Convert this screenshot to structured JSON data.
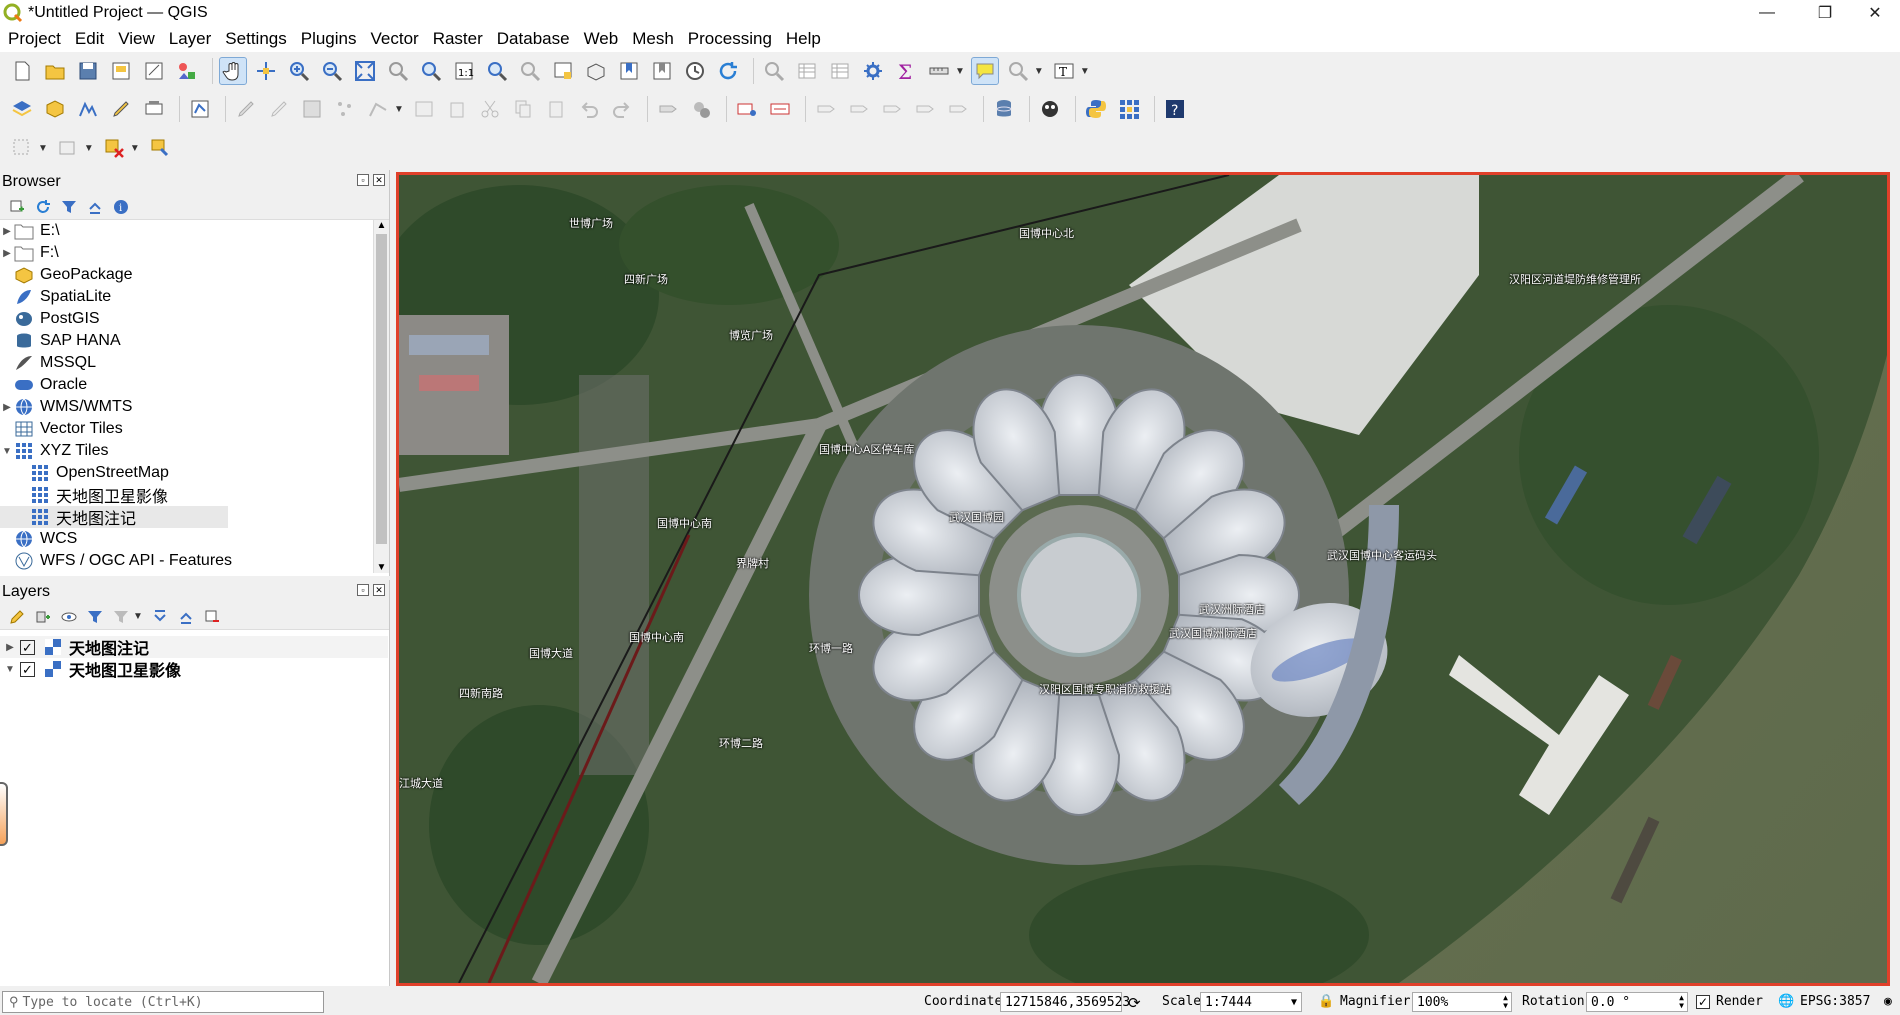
{
  "window": {
    "title": "*Untitled Project — QGIS"
  },
  "menu": [
    "Project",
    "Edit",
    "View",
    "Layer",
    "Settings",
    "Plugins",
    "Vector",
    "Raster",
    "Database",
    "Web",
    "Mesh",
    "Processing",
    "Help"
  ],
  "browser": {
    "title": "Browser",
    "items": [
      {
        "label": "E:\\",
        "expander": true
      },
      {
        "label": "F:\\",
        "expander": true
      },
      {
        "label": "GeoPackage",
        "expander": false
      },
      {
        "label": "SpatiaLite",
        "expander": false
      },
      {
        "label": "PostGIS",
        "expander": false
      },
      {
        "label": "SAP HANA",
        "expander": false
      },
      {
        "label": "MSSQL",
        "expander": false
      },
      {
        "label": "Oracle",
        "expander": false
      },
      {
        "label": "WMS/WMTS",
        "expander": true
      },
      {
        "label": "Vector Tiles",
        "expander": false
      },
      {
        "label": "XYZ Tiles",
        "expander": true,
        "open": true
      },
      {
        "label": "OpenStreetMap",
        "child": true
      },
      {
        "label": "天地图卫星影像",
        "child": true
      },
      {
        "label": "天地图注记",
        "child": true,
        "selected": true
      },
      {
        "label": "WCS",
        "expander": false
      },
      {
        "label": "WFS / OGC API - Features",
        "expander": false
      }
    ]
  },
  "layers": {
    "title": "Layers",
    "items": [
      {
        "label": "天地图注记",
        "checked": true,
        "expanded": false
      },
      {
        "label": "天地图卫星影像",
        "checked": true,
        "expanded": true
      }
    ]
  },
  "map_labels": [
    "国博中心北",
    "汉阳区河道堤防维修管理所",
    "国博中心南",
    "国博中心A区停车库",
    "武汉国博园",
    "武汉国博中心客运码头",
    "武汉洲际酒店",
    "武汉国博洲际酒店",
    "汉阳区国博专职消防救援站",
    "国博中心南",
    "界牌村",
    "世博广场",
    "四新广场",
    "博览广场",
    "国博大道",
    "四新南路",
    "江城大道",
    "环博一路",
    "环博二路"
  ],
  "status": {
    "locate_placeholder": "Type to locate (Ctrl+K)",
    "coordinate_label": "Coordinate",
    "coordinate_value": "12715846,3569523",
    "scale_label": "Scale",
    "scale_value": "1:7444",
    "magnifier_label": "Magnifier",
    "magnifier_value": "100%",
    "rotation_label": "Rotation",
    "rotation_value": "0.0 °",
    "render_label": "Render",
    "crs_value": "EPSG:3857"
  },
  "colors": {
    "map_border": "#e0402a",
    "selection": "#cfe3f7"
  }
}
